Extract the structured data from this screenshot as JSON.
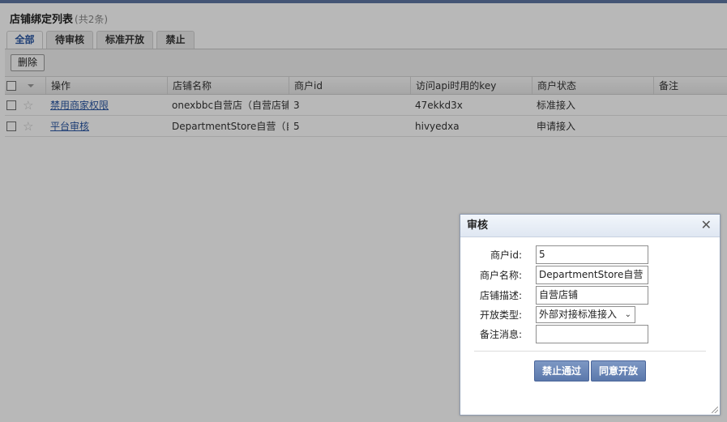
{
  "page": {
    "title": "店铺绑定列表",
    "count": "(共2条)"
  },
  "tabs": [
    {
      "label": "全部",
      "active": true
    },
    {
      "label": "待审核",
      "active": false
    },
    {
      "label": "标准开放",
      "active": false
    },
    {
      "label": "禁止",
      "active": false
    }
  ],
  "toolbar": {
    "delete_label": "删除"
  },
  "grid": {
    "columns": [
      "操作",
      "店铺名称",
      "商户id",
      "访问api时用的key",
      "商户状态",
      "备注"
    ],
    "rows": [
      {
        "action": "禁用商家权限",
        "store_name": "onexbbc自营店（自营店铺",
        "merchant_id": "3",
        "api_key": "47ekkd3x",
        "status": "标准接入",
        "remark": ""
      },
      {
        "action": "平台审核",
        "store_name": "DepartmentStore自营（自",
        "merchant_id": "5",
        "api_key": "hivyedxa",
        "status": "申请接入",
        "remark": ""
      }
    ]
  },
  "dialog": {
    "title": "审核",
    "close_symbol": "✕",
    "fields": {
      "merchant_id": {
        "label": "商户id:",
        "value": "5"
      },
      "merchant_name": {
        "label": "商户名称:",
        "value": "DepartmentStore自营（"
      },
      "store_desc": {
        "label": "店铺描述:",
        "value": "自营店铺"
      },
      "open_type": {
        "label": "开放类型:",
        "value": "外部对接标准接入"
      },
      "remark": {
        "label": "备注消息:",
        "value": ""
      }
    },
    "reject_label": "禁止通过",
    "approve_label": "同意开放"
  },
  "colors": {
    "overlay": "rgba(0,0,0,0.28)",
    "active_tab_text": "#2a57a3",
    "link": "#2a57a3",
    "dialog_button": "#5b78ab",
    "top_bar": "#5f77a2"
  }
}
